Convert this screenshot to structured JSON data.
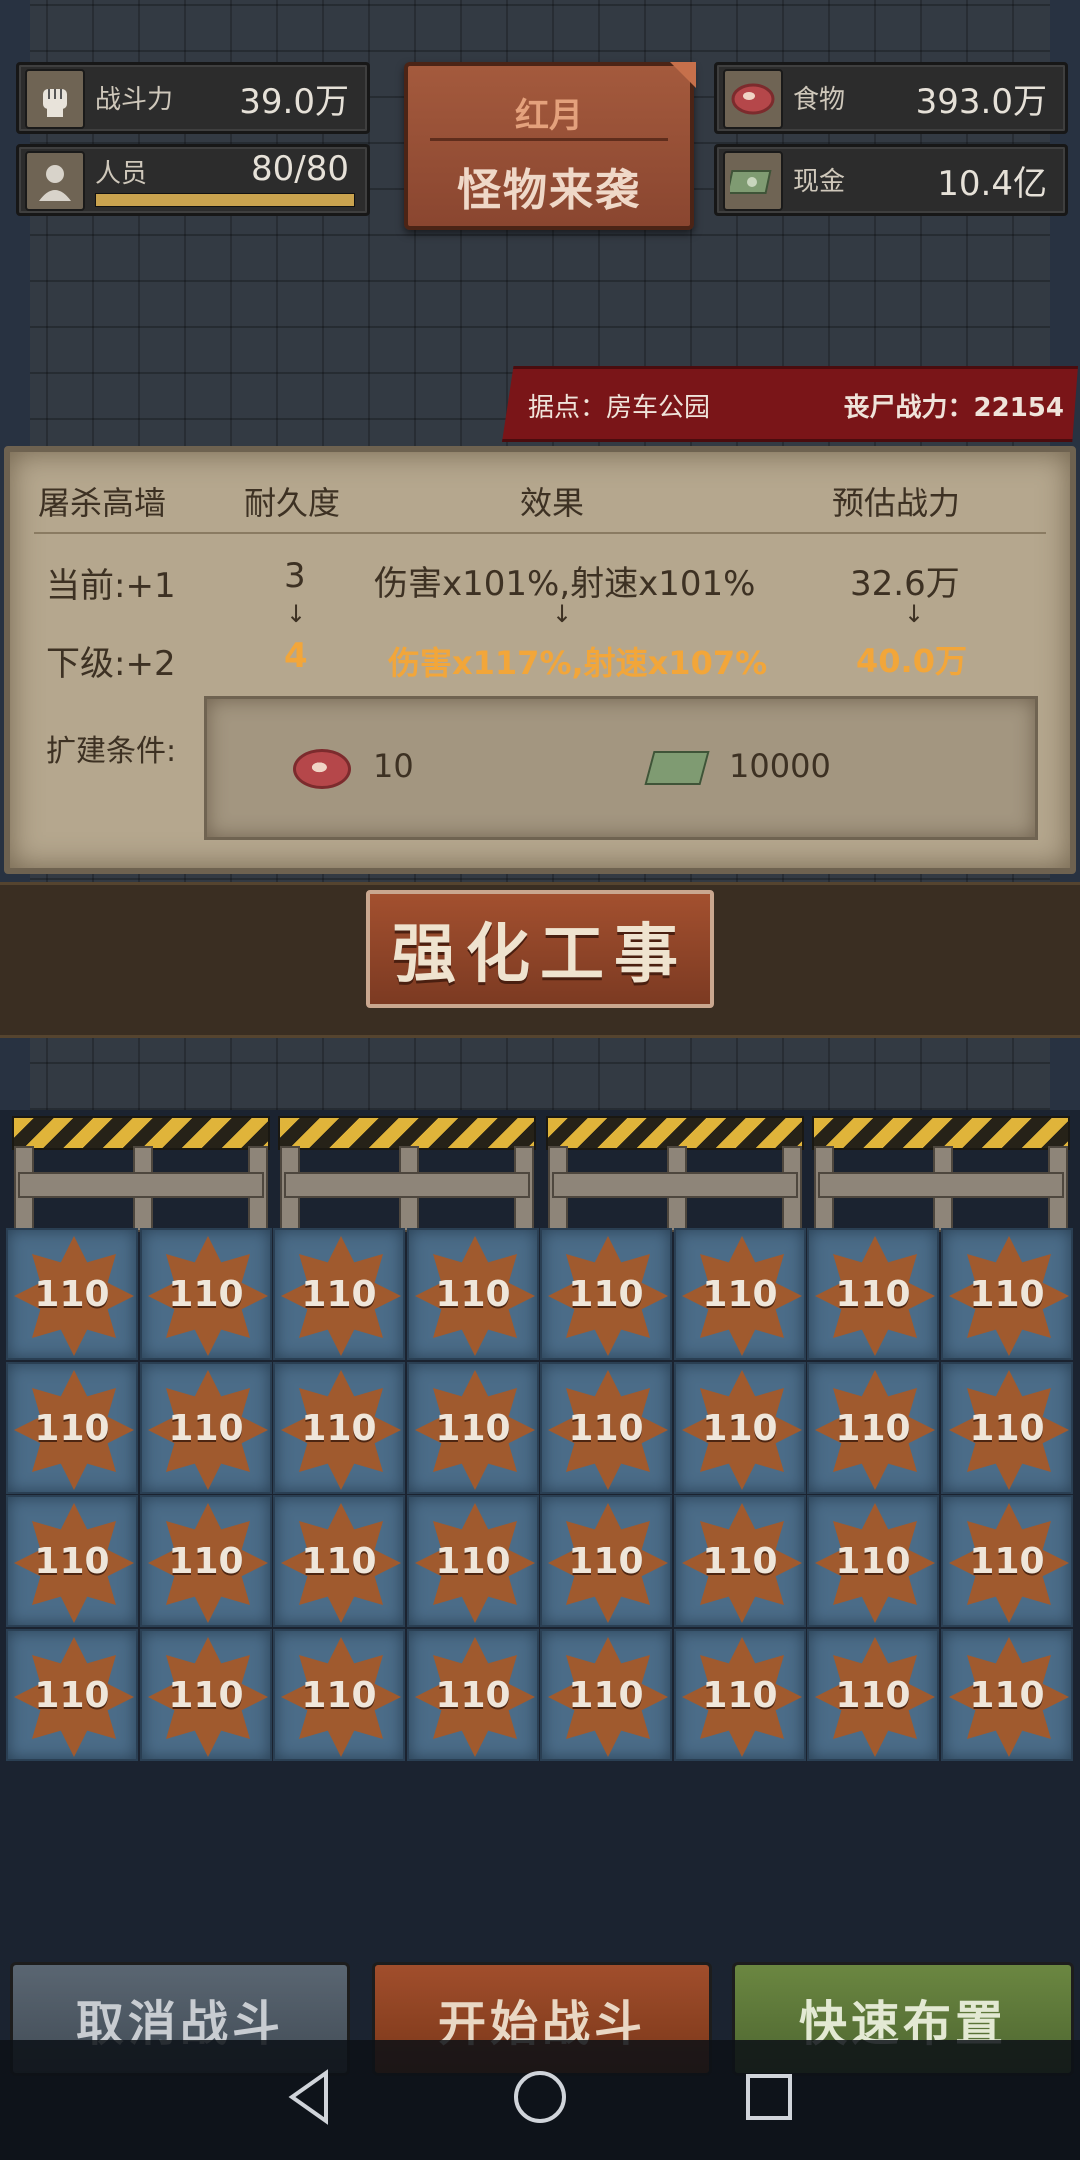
{
  "resources": {
    "combat_power": {
      "label": "战斗力",
      "value": "39.0万",
      "icon": "fist-icon"
    },
    "personnel": {
      "label": "人员",
      "value": "80/80",
      "icon": "person-icon",
      "fill_fraction": 1.0
    },
    "food": {
      "label": "食物",
      "value": "393.0万",
      "icon": "meat-icon"
    },
    "cash": {
      "label": "现金",
      "value": "10.4亿",
      "icon": "cash-icon"
    }
  },
  "event": {
    "subtitle": "红月",
    "title": "怪物来袭"
  },
  "stronghold": {
    "location": "据点：房车公园",
    "zombie_power": "丧尸战力：22154"
  },
  "panel": {
    "headers": [
      "屠杀高墙",
      "耐久度",
      "效果",
      "预估战力"
    ],
    "current": {
      "level": "当前:+1",
      "durability": "3",
      "effect": "伤害x101%,射速x101%",
      "power": "32.6万"
    },
    "next": {
      "level": "下级:+2",
      "durability": "4",
      "effect": "伤害x117%,射速x107%",
      "power": "40.0万"
    },
    "arrow": "↓",
    "condition_label": "扩建条件:",
    "costs": {
      "food": "10",
      "cash": "10000"
    }
  },
  "upgrade_button": "强化工事",
  "grid": {
    "rows": [
      [
        "110",
        "110",
        "110",
        "110",
        "110",
        "110",
        "110",
        "110"
      ],
      [
        "110",
        "110",
        "110",
        "110",
        "110",
        "110",
        "110",
        "110"
      ],
      [
        "110",
        "110",
        "110",
        "110",
        "110",
        "110",
        "110",
        "110"
      ],
      [
        "110",
        "110",
        "110",
        "110",
        "110",
        "110",
        "110",
        "110"
      ]
    ]
  },
  "buttons": {
    "cancel": "取消战斗",
    "start": "开始战斗",
    "quick": "快速布置"
  },
  "colors": {
    "accent_orange": "#f2a63a",
    "banner_red": "#7a1518",
    "tile_blue": "#4b6c88"
  }
}
